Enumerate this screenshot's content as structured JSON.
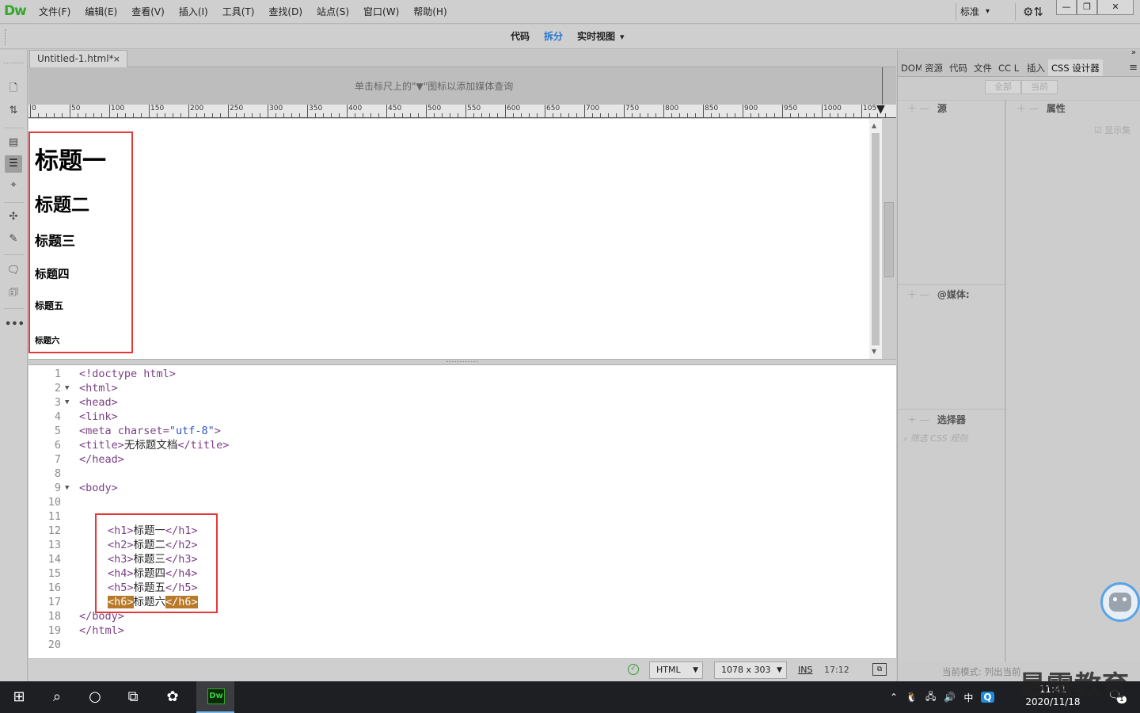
{
  "app": {
    "logo": "Dw"
  },
  "menubar": {
    "items": [
      "文件(F)",
      "编辑(E)",
      "查看(V)",
      "插入(I)",
      "工具(T)",
      "查找(D)",
      "站点(S)",
      "窗口(W)",
      "帮助(H)"
    ],
    "workspace": "标准",
    "workspace_arrow": "▾"
  },
  "window_controls": {
    "minimize": "—",
    "restore": "❐",
    "close": "✕"
  },
  "viewbar": {
    "code": "代码",
    "split": "拆分",
    "live": "实时视图",
    "live_arrow": "▾"
  },
  "document": {
    "tab_title": "Untitled-1.html*",
    "tab_close": "×",
    "media_query_hint": "单击标尺上的\"▼\"图标以添加媒体查询"
  },
  "ruler": {
    "labels": [
      "0",
      "50",
      "100",
      "150",
      "200",
      "250",
      "300",
      "350",
      "400",
      "450",
      "500",
      "550",
      "600",
      "650",
      "700",
      "750",
      "800",
      "850",
      "900",
      "950",
      "1000",
      "105"
    ]
  },
  "live_view": {
    "h1": "标题一",
    "h2": "标题二",
    "h3": "标题三",
    "h4": "标题四",
    "h5": "标题五",
    "h6": "标题六"
  },
  "code": {
    "line_numbers": [
      "1",
      "2",
      "3",
      "4",
      "5",
      "6",
      "7",
      "8",
      "9",
      "10",
      "11",
      "12",
      "13",
      "14",
      "15",
      "16",
      "17",
      "18",
      "19",
      "20"
    ],
    "l1": "<!doctype html>",
    "l2": "<html>",
    "l3": "<head>",
    "l4": "<link>",
    "l5a": "<meta ",
    "l5b": "charset",
    "l5c": "=",
    "l5d": "\"utf-8\"",
    "l5e": ">",
    "l6a": "<title>",
    "l6b": "无标题文档",
    "l6c": "</title>",
    "l7": "</head>",
    "l9": "<body>",
    "h1o": "<h1>",
    "h1t": "标题一",
    "h1c": "</h1>",
    "h2o": "<h2>",
    "h2t": "标题二",
    "h2c": "</h2>",
    "h3o": "<h3>",
    "h3t": "标题三",
    "h3c": "</h3>",
    "h4o": "<h4>",
    "h4t": "标题四",
    "h4c": "</h4>",
    "h5o": "<h5>",
    "h5t": "标题五",
    "h5c": "</h5>",
    "h6o": "<h6>",
    "h6t": "标题六",
    "h6c": "</h6>",
    "l18": "</body>",
    "l19": "</html>"
  },
  "statusbar": {
    "language": "HTML",
    "size": "1078 x 303",
    "mode": "INS",
    "position": "17:12"
  },
  "right_panel": {
    "tabs": [
      "DOM",
      "资源",
      "代码",
      "文件",
      "CC L",
      "插入",
      "CSS 设计器"
    ],
    "seg_all": "全部",
    "seg_current": "当前",
    "sources": "源",
    "properties": "属性",
    "show_set": "显示集",
    "media": "@媒体:",
    "selectors": "选择器",
    "filter_placeholder": "筛选 CSS 规则",
    "status": "当前模式: 列出当前"
  },
  "taskbar": {
    "time": "11:41",
    "date": "2020/11/18",
    "ime": "中",
    "notif_count": "1"
  },
  "watermark": "最需教育"
}
